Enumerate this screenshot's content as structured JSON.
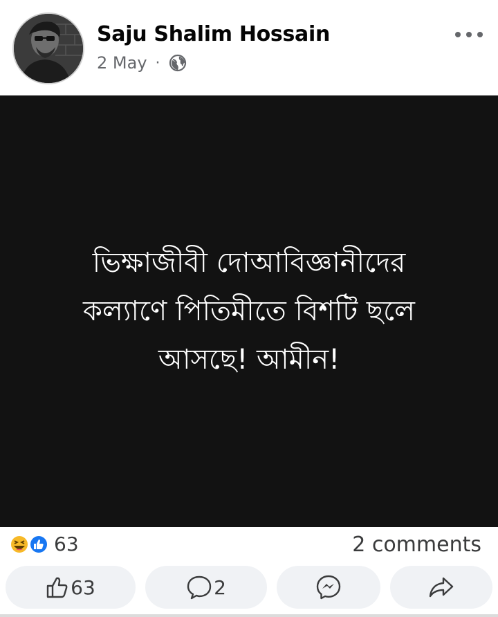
{
  "post": {
    "author": "Saju Shalim Hossain",
    "date": "2 May",
    "separator": "·",
    "privacy_icon": "globe-icon",
    "text_lines": [
      "ভিক্ষাজীবী দোআবিজ্ঞানীদের",
      "কল্যাণে পিতিমীতে বিশটি ছলে",
      "আসছে! আমীন!"
    ],
    "background_color": "#121212",
    "text_color": "#ffffff"
  },
  "reactions": {
    "icons": [
      "haha-emoji-icon",
      "like-reaction-icon"
    ],
    "count": "63",
    "comments": "2 comments"
  },
  "actions": {
    "like_count": "63",
    "comment_count": "2",
    "messenger_icon": "messenger-icon",
    "share_icon": "share-icon"
  },
  "colors": {
    "meta_gray": "#65676b",
    "button_bg": "#f0f2f5",
    "like_blue": "#1877f2",
    "haha_yellow": "#f7b928"
  }
}
